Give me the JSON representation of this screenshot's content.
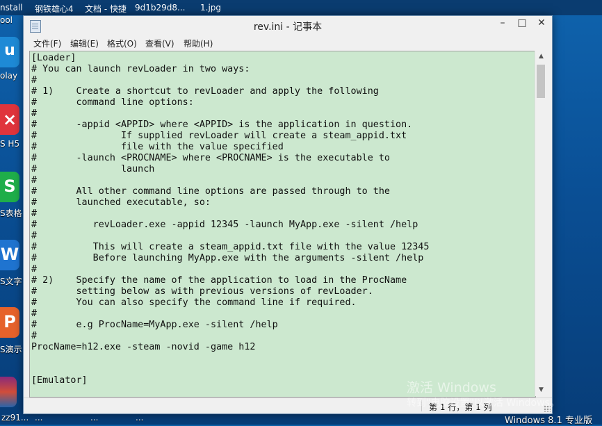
{
  "taskbar_top": {
    "items": [
      "nstall",
      "钢铁雄心4",
      "文档 - 快捷",
      "9d1b29d8...",
      "1.jpg"
    ]
  },
  "dock": {
    "labels": [
      "ool",
      "olay",
      "S H5",
      "S表格",
      "S文字",
      "S演示"
    ],
    "glyphs": [
      "u",
      "×",
      "S",
      "W",
      "P"
    ]
  },
  "bottom_strip": {
    "items": [
      "zz91...",
      "...",
      "...",
      "...",
      "Windows 8.1 专业版"
    ]
  },
  "window": {
    "title": "rev.ini - 记事本",
    "controls": {
      "minimize": "–",
      "maximize": "□",
      "close": "✕"
    }
  },
  "menu": [
    {
      "label": "文件(F)"
    },
    {
      "label": "编辑(E)"
    },
    {
      "label": "格式(O)"
    },
    {
      "label": "查看(V)"
    },
    {
      "label": "帮助(H)"
    }
  ],
  "editor": {
    "content": "[Loader]\n# You can launch revLoader in two ways:\n#\n# 1)    Create a shortcut to revLoader and apply the following\n#       command line options:\n#\n#       -appid <APPID> where <APPID> is the application in question.\n#               If supplied revLoader will create a steam_appid.txt\n#               file with the value specified\n#       -launch <PROCNAME> where <PROCNAME> is the executable to\n#               launch\n#\n#       All other command line options are passed through to the\n#       launched executable, so:\n#\n#          revLoader.exe -appid 12345 -launch MyApp.exe -silent /help\n#\n#          This will create a steam_appid.txt file with the value 12345\n#          Before launching MyApp.exe with the arguments -silent /help\n#\n# 2)    Specify the name of the application to load in the ProcName\n#       setting below as with previous versions of revLoader.\n#       You can also specify the command line if required.\n#\n#       e.g ProcName=MyApp.exe -silent /help\n#\nProcName=h12.exe -steam -novid -game h12\n\n\n[Emulator]"
  },
  "status": {
    "position": "第 1 行，第 1 列"
  },
  "watermark": {
    "title": "激活 Windows",
    "subtitle": "转到\"电脑设置\"以激活 Windows。"
  }
}
